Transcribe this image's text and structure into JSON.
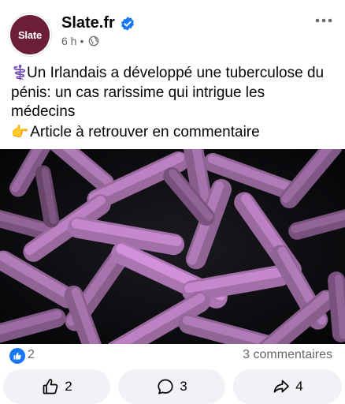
{
  "post": {
    "author": {
      "name": "Slate.fr",
      "avatar_text": "Slate",
      "verified": true
    },
    "meta": {
      "time": "6 h",
      "separator": "•",
      "audience_icon": "globe-icon"
    },
    "text_lines": [
      {
        "emoji": "⚕️",
        "text": "Un Irlandais a développé une tuberculose du"
      },
      {
        "emoji": "",
        "text": "pénis: un cas rarissime qui intrigue les"
      },
      {
        "emoji": "",
        "text": "médecins"
      },
      {
        "emoji": "👉",
        "text": " Article à retrouver en commentaire"
      }
    ],
    "image": {
      "icon": "bacteria-photo"
    },
    "stats": {
      "reactions": "2",
      "comments": "3 commentaires"
    },
    "actions": {
      "like_count": "2",
      "comment_count": "3",
      "share_count": "4"
    }
  },
  "colors": {
    "brand": "#6b1d3a",
    "verified": "#1877f2",
    "secondary_text": "#65676b",
    "button_bg": "#f0f2f5",
    "bacteria": "#c98ad0"
  }
}
